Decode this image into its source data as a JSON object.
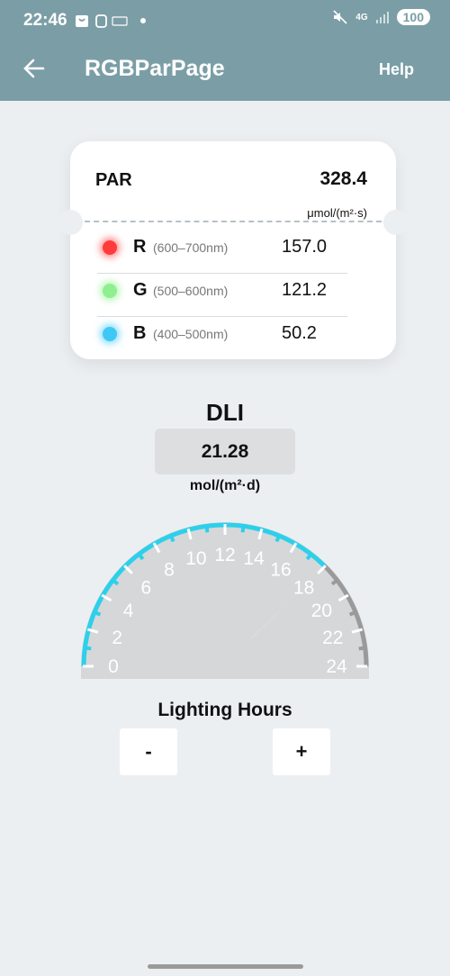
{
  "status_bar": {
    "time": "22:46",
    "battery": "100",
    "network": "4G"
  },
  "app_bar": {
    "title": "RGBParPage",
    "help_label": "Help"
  },
  "par_card": {
    "label": "PAR",
    "value": "328.4",
    "unit": "μmol/(m²·s)",
    "rows": [
      {
        "channel": "R",
        "range": "(600–700nm)",
        "value": "157.0",
        "color": "#ff3b3b"
      },
      {
        "channel": "G",
        "range": "(500–600nm)",
        "value": "121.2",
        "color": "#8ff08f"
      },
      {
        "channel": "B",
        "range": "(400–500nm)",
        "value": "50.2",
        "color": "#3fc8f5"
      }
    ]
  },
  "dli": {
    "title": "DLI",
    "value": "21.28",
    "unit": "mol/(m²·d)"
  },
  "gauge": {
    "min": 0,
    "max": 24,
    "value": 18,
    "labels": [
      "0",
      "2",
      "4",
      "6",
      "8",
      "10",
      "12",
      "14",
      "16",
      "18",
      "20",
      "22",
      "24"
    ],
    "active_color": "#2dd0ea",
    "inactive_color": "#9a9a9a"
  },
  "lighting_hours": {
    "label": "Lighting Hours",
    "minus_label": "-",
    "plus_label": "+"
  }
}
